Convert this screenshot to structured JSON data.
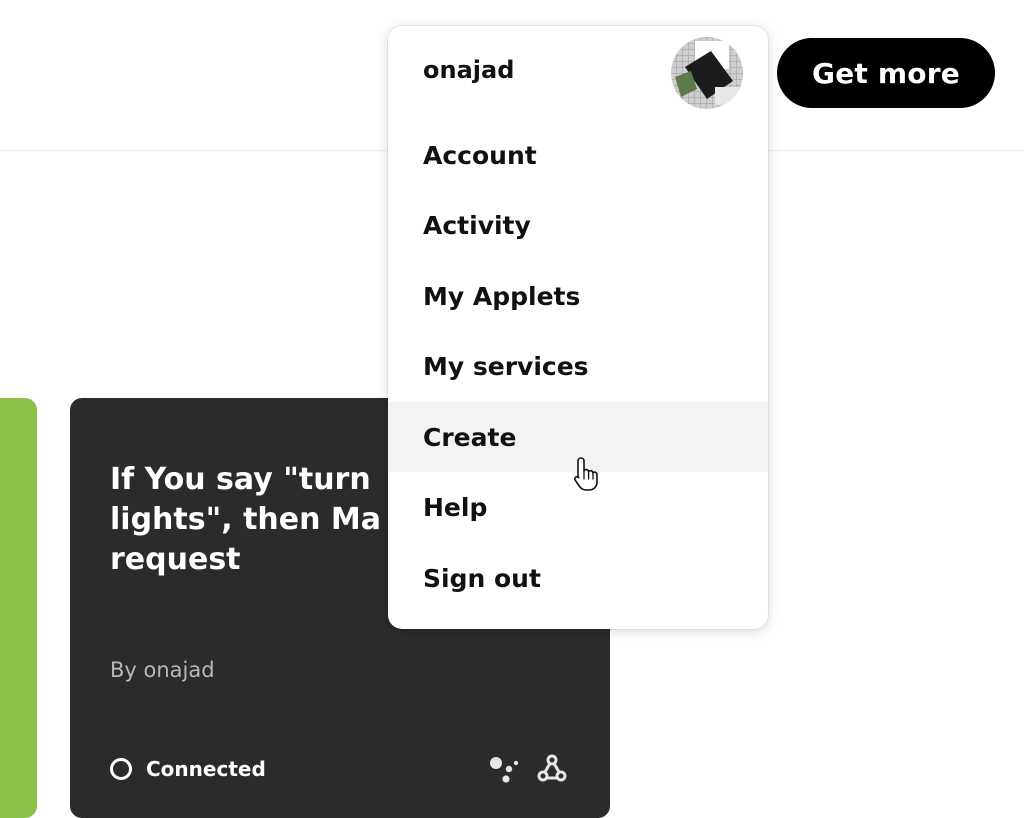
{
  "header": {
    "get_more_label": "Get more"
  },
  "applet_card": {
    "title": "If You say \"turn\nlights\", then Ma\nrequest",
    "author": "By onajad",
    "status": "Connected",
    "service_icons": [
      "google-assistant-icon",
      "webhooks-icon"
    ]
  },
  "dropdown": {
    "username": "onajad",
    "items": [
      {
        "label": "Account"
      },
      {
        "label": "Activity"
      },
      {
        "label": "My Applets"
      },
      {
        "label": "My services"
      },
      {
        "label": "Create"
      },
      {
        "label": "Help"
      },
      {
        "label": "Sign out"
      }
    ],
    "hovered_item": "Create"
  },
  "colors": {
    "green_card": "#8bc34a",
    "dark_card": "#2b2b2b",
    "button_bg": "#000000",
    "hover_bg": "#f3f3f5"
  }
}
